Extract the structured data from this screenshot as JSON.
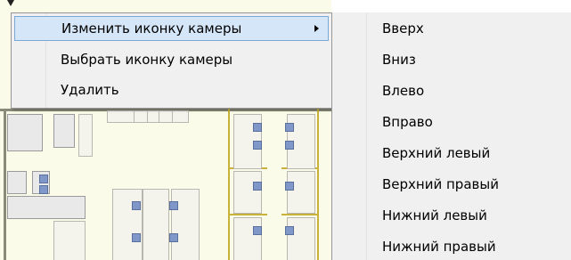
{
  "context_menu": {
    "items": [
      {
        "label": "Изменить иконку камеры",
        "has_submenu": true,
        "highlighted": true
      },
      {
        "label": "Выбрать иконку камеры",
        "has_submenu": false,
        "highlighted": false
      },
      {
        "label": "Удалить",
        "has_submenu": false,
        "highlighted": false
      }
    ]
  },
  "submenu": {
    "items": [
      {
        "label": "Вверх"
      },
      {
        "label": "Вниз"
      },
      {
        "label": "Влево"
      },
      {
        "label": "Вправо"
      },
      {
        "label": "Верхний левый"
      },
      {
        "label": "Верхний правый"
      },
      {
        "label": "Нижний левый"
      },
      {
        "label": "Нижний правый"
      }
    ]
  },
  "icons": {
    "submenu_arrow": "chevron-right-icon"
  },
  "colors": {
    "menu_background": "#f0f0f0",
    "highlight_background": "#d5e6f8",
    "highlight_border": "#7aa8d8",
    "floorplan_background": "#fbfbe9",
    "chair_color": "#7f98c9"
  }
}
